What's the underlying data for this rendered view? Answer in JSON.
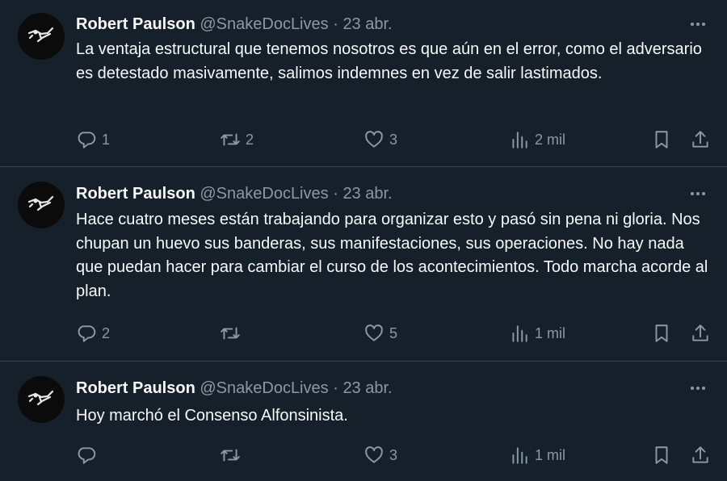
{
  "tweets": [
    {
      "name": "Robert Paulson",
      "handle": "@SnakeDocLives",
      "dot": "·",
      "date": "23 abr.",
      "text": "La ventaja estructural que tenemos nosotros es que aún en el error, como el adversario es detestado masivamente, salimos indemnes en vez de salir lastimados.",
      "replies": "1",
      "retweets": "2",
      "likes": "3",
      "views": "2 mil"
    },
    {
      "name": "Robert Paulson",
      "handle": "@SnakeDocLives",
      "dot": "·",
      "date": "23 abr.",
      "text": "Hace cuatro meses están trabajando para organizar esto y pasó sin pena ni gloria. Nos chupan un huevo sus banderas, sus manifestaciones, sus operaciones. No hay nada que puedan hacer para cambiar el curso de los acontecimientos. Todo marcha acorde al plan.",
      "replies": "2",
      "retweets": "",
      "likes": "5",
      "views": "1 mil"
    },
    {
      "name": "Robert Paulson",
      "handle": "@SnakeDocLives",
      "dot": "·",
      "date": "23 abr.",
      "text": "Hoy marchó el Consenso Alfonsinista.",
      "replies": "",
      "retweets": "",
      "likes": "3",
      "views": "1 mil"
    }
  ],
  "colors": {
    "background": "#15202b",
    "text": "#f7f9f9",
    "secondary": "#8b98a5",
    "divider": "#38444d"
  },
  "icons": [
    "more-icon",
    "reply-icon",
    "retweet-icon",
    "like-icon",
    "views-icon",
    "bookmark-icon",
    "share-icon"
  ]
}
